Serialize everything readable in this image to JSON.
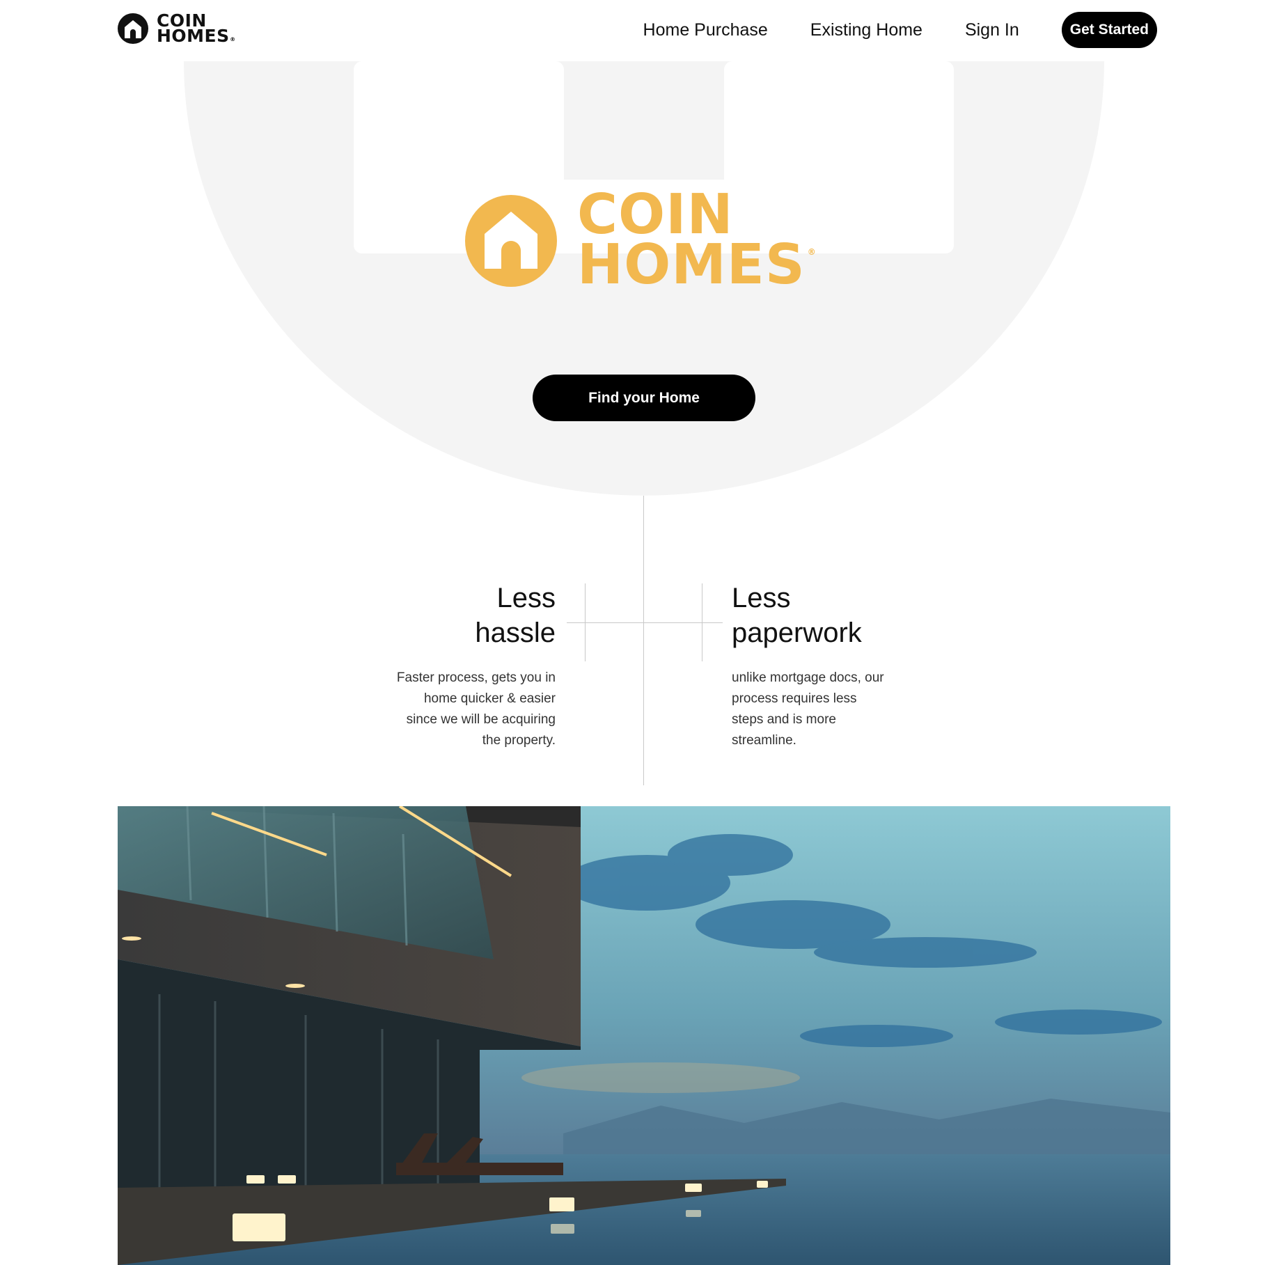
{
  "header": {
    "logo": {
      "line1": "COIN",
      "line2": "HOMES",
      "reg": "®"
    },
    "nav": [
      {
        "label": "Home Purchase"
      },
      {
        "label": "Existing Home"
      },
      {
        "label": "Sign In"
      }
    ],
    "cta_label": "Get Started"
  },
  "hero": {
    "brand": {
      "line1": "COIN",
      "line2": "HOMES",
      "reg": "®"
    },
    "button_label": "Find your Home"
  },
  "features": [
    {
      "title_line1": "Less",
      "title_line2": "hassle",
      "desc_lines": [
        "Faster process, gets you in",
        "home quicker & easier",
        "since we will be acquiring",
        "the property."
      ]
    },
    {
      "title_line1": "Less",
      "title_line2": "paperwork",
      "desc_lines": [
        "unlike mortgage docs, our",
        "process requires less",
        "steps and is more",
        "streamline."
      ]
    }
  ],
  "colors": {
    "brand": "#f2b84f",
    "hero_bg": "#f4f4f4",
    "button": "#000000",
    "divider": "#c8c8c8"
  },
  "icons": {
    "logo": "house-circle-icon"
  }
}
